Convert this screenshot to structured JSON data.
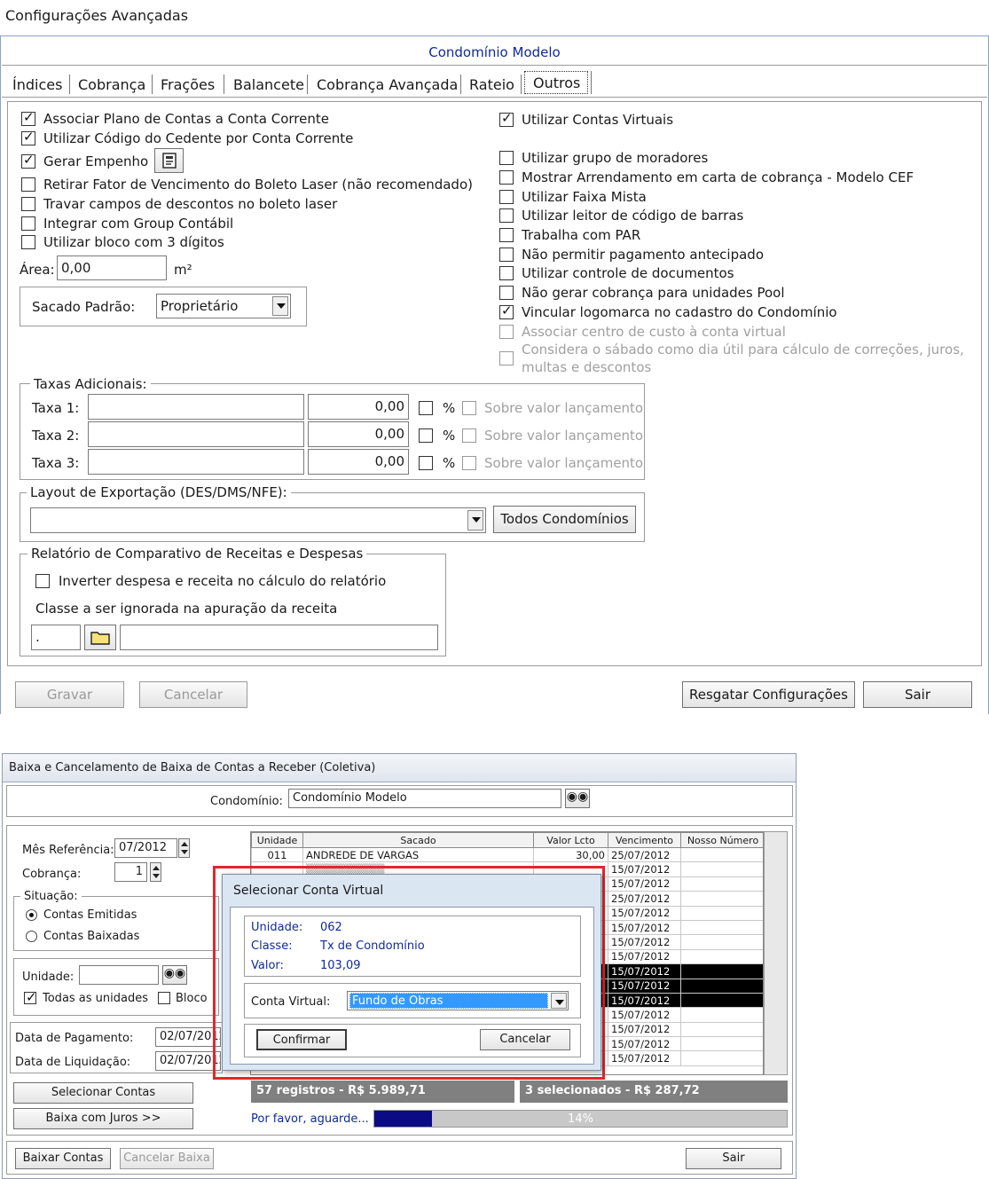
{
  "win1": {
    "title": "Configurações Avançadas",
    "header": "Condomínio Modelo",
    "tabs": [
      "Índices",
      "Cobrança",
      "Frações",
      "Balancete",
      "Cobrança Avançada",
      "Rateio",
      "Outros"
    ],
    "left_checks": [
      {
        "label": "Associar Plano de Contas a Conta Corrente",
        "checked": true
      },
      {
        "label": "Utilizar Código do Cedente por Conta Corrente",
        "checked": true
      },
      {
        "label": "Gerar Empenho",
        "checked": true
      },
      {
        "label": "Retirar Fator de Vencimento do Boleto Laser (não recomendado)",
        "checked": false
      },
      {
        "label": "Travar campos de descontos no boleto laser",
        "checked": false
      },
      {
        "label": "Integrar com Group Contábil",
        "checked": false
      },
      {
        "label": "Utilizar bloco com 3 dígitos",
        "checked": false
      }
    ],
    "area": {
      "label": "Área:",
      "value": "0,00",
      "unit": "m²"
    },
    "sacado": {
      "label": "Sacado Padrão:",
      "value": "Proprietário"
    },
    "right_checks": [
      {
        "label": "Utilizar Contas Virtuais",
        "checked": true
      },
      {
        "label": "Utilizar grupo de moradores",
        "checked": false
      },
      {
        "label": "Mostrar Arrendamento em carta de cobrança - Modelo CEF",
        "checked": false
      },
      {
        "label": "Utilizar Faixa Mista",
        "checked": false
      },
      {
        "label": "Utilizar leitor de código de barras",
        "checked": false
      },
      {
        "label": "Trabalha com PAR",
        "checked": false
      },
      {
        "label": "Não permitir pagamento antecipado",
        "checked": false
      },
      {
        "label": "Utilizar controle de documentos",
        "checked": false
      },
      {
        "label": "Não gerar cobrança para unidades Pool",
        "checked": false
      },
      {
        "label": "Vincular logomarca no cadastro do Condomínio",
        "checked": true
      },
      {
        "label": "Associar centro de custo à conta virtual",
        "checked": false
      },
      {
        "label": "Considera o sábado como dia útil para cálculo de correções, juros,",
        "label2": "multas e descontos",
        "checked": false
      }
    ],
    "taxas": {
      "title": "Taxas Adicionais:",
      "rows": [
        {
          "label": "Taxa 1:",
          "value": "0,00",
          "pct": "%",
          "sobre": "Sobre valor lançamento"
        },
        {
          "label": "Taxa 2:",
          "value": "0,00",
          "pct": "%",
          "sobre": "Sobre valor lançamento"
        },
        {
          "label": "Taxa 3:",
          "value": "0,00",
          "pct": "%",
          "sobre": "Sobre valor lançamento"
        }
      ]
    },
    "layout": {
      "title": "Layout de Exportação (DES/DMS/NFE):",
      "button": "Todos Condomínios"
    },
    "relatorio": {
      "title": "Relatório de Comparativo de Receitas e Despesas",
      "check": "Inverter despesa e receita no cálculo do relatório",
      "classe_label": "Classe a ser ignorada na apuração da receita",
      "classe_code": "."
    },
    "buttons": {
      "gravar": "Gravar",
      "cancelar": "Cancelar",
      "resgatar": "Resgatar Configurações",
      "sair": "Sair"
    }
  },
  "win2": {
    "title": "Baixa e Cancelamento de Baixa de Contas a Receber (Coletiva)",
    "condominio_label": "Condomínio:",
    "condominio_value": "Condomínio Modelo",
    "mes_label": "Mês Referência:",
    "mes_value": "07/2012",
    "cobranca_label": "Cobrança:",
    "cobranca_value": "1",
    "situacao_title": "Situação:",
    "radio_emitidas": "Contas Emitidas",
    "radio_baixadas": "Contas Baixadas",
    "unidade_label": "Unidade:",
    "todas_label": "Todas as unidades",
    "bloco_label": "Bloco",
    "data_pag_label": "Data de Pagamento:",
    "data_pag_value": "02/07/2012",
    "data_liq_label": "Data de Liquidação:",
    "data_liq_value": "02/07/2012",
    "btn_selecionar": "Selecionar Contas",
    "btn_baixa_juros": "Baixa com Juros >>",
    "columns": [
      "Unidade",
      "Sacado",
      "Valor Lcto",
      "Vencimento",
      "Nosso Número"
    ],
    "first_row": {
      "unidade": "011",
      "sacado": "ANDREDE DE VARGAS",
      "valor": "30,00",
      "venc": "25/07/2012"
    },
    "vencimentos": [
      "15/07/2012",
      "15/07/2012",
      "25/07/2012",
      "15/07/2012",
      "15/07/2012",
      "15/07/2012",
      "15/07/2012",
      "15/07/2012",
      "15/07/2012",
      "15/07/2012",
      "15/07/2012",
      "15/07/2012",
      "15/07/2012",
      "15/07/2012"
    ],
    "status_registros": "57 registros - R$ 5.989,71",
    "status_selecionados": "3 selecionados - R$ 287,72",
    "progress_label": "Por favor, aguarde...",
    "progress_pct": "14%",
    "progress_value": 14,
    "btn_baixar": "Baixar Contas",
    "btn_cancelar_baixa": "Cancelar Baixa",
    "btn_sair": "Sair"
  },
  "dialog": {
    "title": "Selecionar Conta Virtual",
    "unidade_label": "Unidade:",
    "unidade_value": "062",
    "classe_label": "Classe:",
    "classe_value": "Tx de Condomínio",
    "valor_label": "Valor:",
    "valor_value": "103,09",
    "conta_label": "Conta Virtual:",
    "conta_value": "Fundo de Obras",
    "btn_confirmar": "Confirmar",
    "btn_cancelar": "Cancelar"
  },
  "colors": {
    "accent_blue": "#0f2a9a",
    "highlight_red": "#e3262c",
    "selection": "#3399ff",
    "progress": "#0b0b86"
  }
}
